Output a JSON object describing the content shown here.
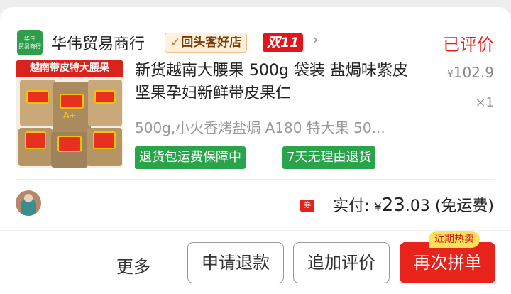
{
  "shop": {
    "logo_line1": "华伟",
    "logo_line2": "贸易商行",
    "name": "华伟贸易商行",
    "repeat_badge": "回头客好店",
    "sale_badge": "双11",
    "arrow": "›"
  },
  "order": {
    "status": "已评价"
  },
  "product": {
    "thumb_banner": "越南带皮特大腰果",
    "thumb_grade": "A+",
    "title": "新货越南大腰果 500g 袋装 盐焗味紫皮坚果孕妇新鲜带皮果仁",
    "price_currency": "¥",
    "price": "102.9",
    "quantity": "×1",
    "spec": "500g,小火香烤盐焗 A180 特大果 50...",
    "tags": [
      "退货包运费保障中",
      "7天无理由退货"
    ]
  },
  "payment": {
    "coupon_icon": "券",
    "label": "实付:",
    "currency": "¥",
    "amount_int": "23",
    "amount_dec": ".03",
    "shipping": "(免运费)"
  },
  "actions": {
    "more": "更多",
    "refund": "申请退款",
    "add_review": "追加评价",
    "reorder": "再次拼单",
    "hot_badge": "近期热卖"
  },
  "colors": {
    "accent_red": "#e2231a",
    "tag_green": "#2aa44a",
    "badge_gold": "#ffe15a"
  }
}
